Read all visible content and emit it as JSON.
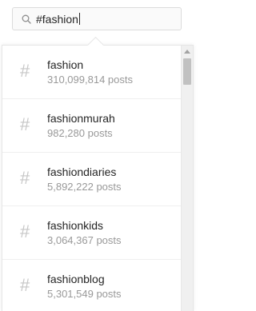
{
  "search": {
    "query": "#fashion",
    "icon": "search-icon"
  },
  "results": [
    {
      "icon": "#",
      "name": "fashion",
      "count": "310,099,814 posts"
    },
    {
      "icon": "#",
      "name": "fashionmurah",
      "count": "982,280 posts"
    },
    {
      "icon": "#",
      "name": "fashiondiaries",
      "count": "5,892,222 posts"
    },
    {
      "icon": "#",
      "name": "fashionkids",
      "count": "3,064,367 posts"
    },
    {
      "icon": "#",
      "name": "fashionblog",
      "count": "5,301,549 posts"
    }
  ],
  "colors": {
    "text": "#262626",
    "muted": "#999999",
    "hash": "#c7c7c7",
    "border": "#dbdbdb"
  }
}
